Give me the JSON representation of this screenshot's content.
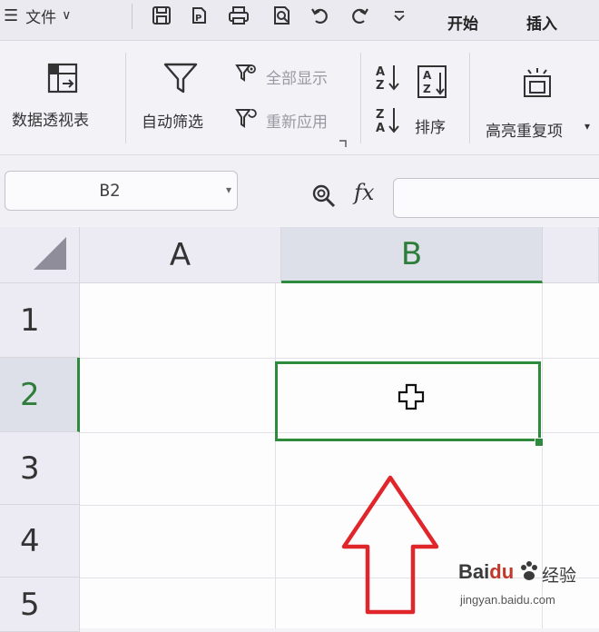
{
  "topbar": {
    "menu_label": "文件",
    "tabs": [
      "开始",
      "插入"
    ]
  },
  "ribbon": {
    "pivot_label": "数据透视表",
    "autofilter_label": "自动筛选",
    "show_all_label": "全部显示",
    "reapply_label": "重新应用",
    "sort_label": "排序",
    "highlight_dup_label": "高亮重复项"
  },
  "formula_bar": {
    "name_box": "B2",
    "fx_label": "fx",
    "formula": ""
  },
  "grid": {
    "columns": [
      "A",
      "B"
    ],
    "rows": [
      "1",
      "2",
      "3",
      "4",
      "5"
    ],
    "selected_cell": "B2"
  },
  "watermark": {
    "brand_a": "Bai",
    "brand_b": "du",
    "brand_cn": "经验",
    "url": "jingyan.baidu.com"
  },
  "colors": {
    "selection": "#2e8b3e",
    "arrow": "#e0262a"
  }
}
